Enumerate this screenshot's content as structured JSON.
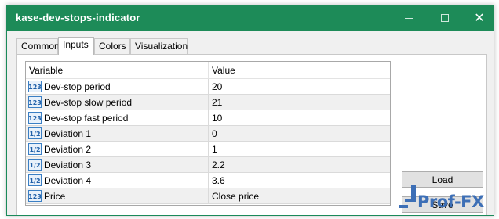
{
  "window": {
    "title": "kase-dev-stops-indicator",
    "accent_color": "#1d8b58",
    "controls": {
      "minimize_icon": "minimize-icon",
      "maximize_icon": "maximize-icon",
      "close_icon": "close-icon",
      "close_glyph": "✕"
    }
  },
  "tabs": [
    {
      "label": "Common",
      "active": false
    },
    {
      "label": "Inputs",
      "active": true
    },
    {
      "label": "Colors",
      "active": false
    },
    {
      "label": "Visualization",
      "active": false
    }
  ],
  "grid": {
    "headers": {
      "variable": "Variable",
      "value": "Value"
    },
    "rows": [
      {
        "icon": "int-type-icon",
        "variable": "Dev-stop period",
        "value": "20"
      },
      {
        "icon": "int-type-icon",
        "variable": "Dev-stop slow period",
        "value": "21"
      },
      {
        "icon": "int-type-icon",
        "variable": "Dev-stop fast period",
        "value": "10"
      },
      {
        "icon": "double-type-icon",
        "variable": "Deviation 1",
        "value": "0"
      },
      {
        "icon": "double-type-icon",
        "variable": "Deviation 2",
        "value": "1"
      },
      {
        "icon": "double-type-icon",
        "variable": "Deviation 3",
        "value": "2.2"
      },
      {
        "icon": "double-type-icon",
        "variable": "Deviation 4",
        "value": "3.6"
      },
      {
        "icon": "int-type-icon",
        "variable": "Price",
        "value": "Close price"
      }
    ]
  },
  "buttons": {
    "load": "Load",
    "save": "Save"
  },
  "watermark": {
    "text": "Prof-FX",
    "color": "#3d6fb6"
  }
}
